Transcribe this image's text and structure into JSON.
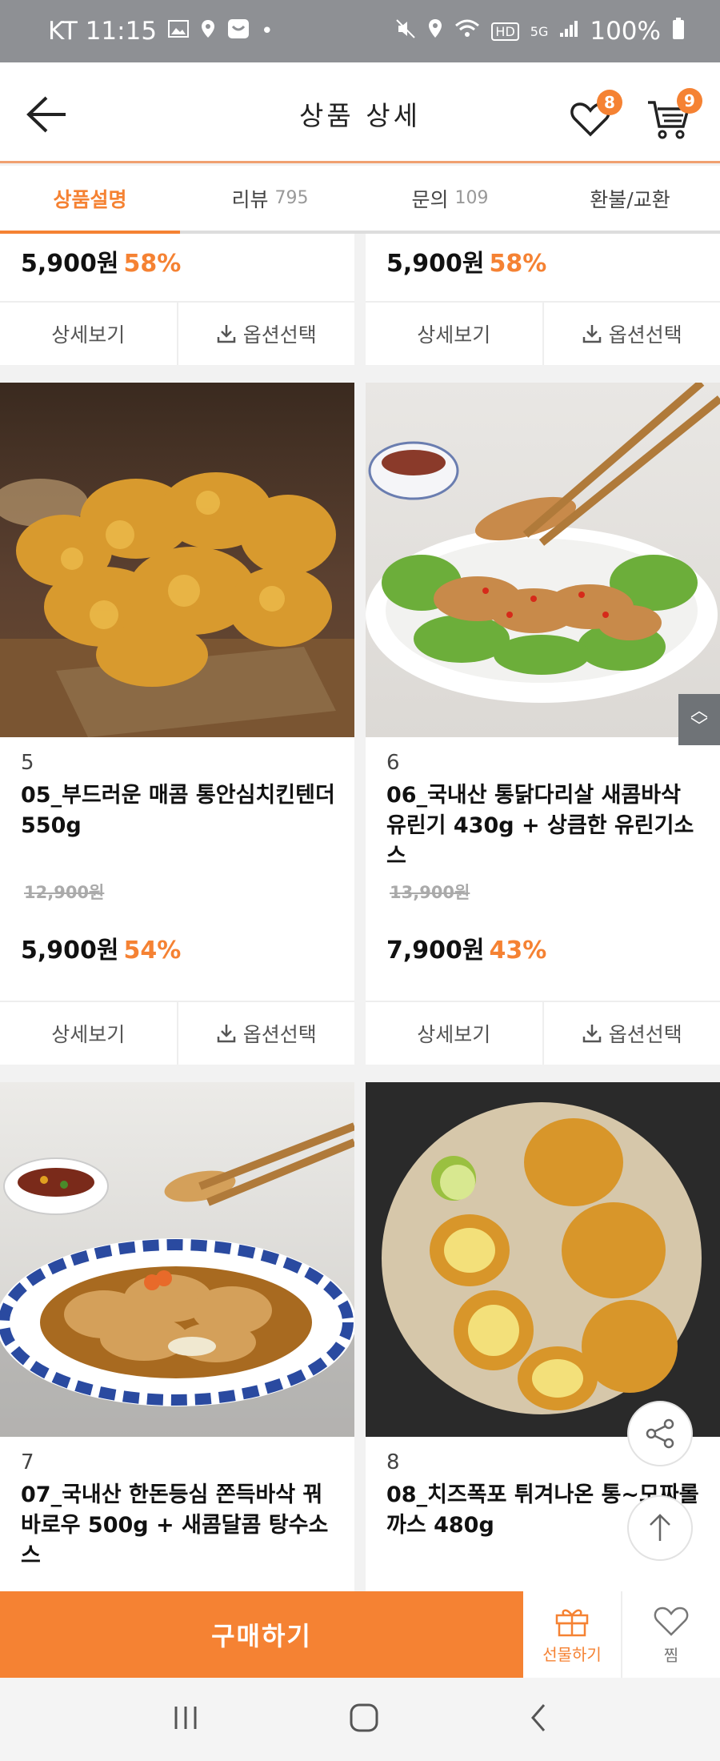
{
  "status": {
    "carrier_time": "KT 11:15",
    "battery": "100%",
    "network_hd": "HD",
    "network_5g": "5G"
  },
  "header": {
    "title": "상품 상세",
    "wishlist_count": "8",
    "cart_count": "9"
  },
  "tabs": [
    {
      "label": "상품설명",
      "count": ""
    },
    {
      "label": "리뷰",
      "count": "795"
    },
    {
      "label": "문의",
      "count": "109"
    },
    {
      "label": "환불/교환",
      "count": ""
    }
  ],
  "partial_row": [
    {
      "price": "5,900원",
      "discount": "58%"
    },
    {
      "price": "5,900원",
      "discount": "58%"
    }
  ],
  "products": [
    {
      "number": "5",
      "name": "05_부드러운 매콤 통안심치킨텐더 550g",
      "original_price": "12,900원",
      "price": "5,900원",
      "discount": "54%"
    },
    {
      "number": "6",
      "name": "06_국내산 통닭다리살 새콤바삭 유린기 430g + 상큼한 유린기소스",
      "original_price": "13,900원",
      "price": "7,900원",
      "discount": "43%"
    },
    {
      "number": "7",
      "name": "07_국내산 한돈등심 쫀득바삭 꿔바로우 500g + 새콤달콤 탕수소스",
      "original_price": "",
      "price": "",
      "discount": ""
    },
    {
      "number": "8",
      "name": "08_치즈폭포 튀겨나온 통~모짜롤까스 480g",
      "original_price": "",
      "price": "",
      "discount": ""
    }
  ],
  "card_actions": {
    "detail": "상세보기",
    "option": "옵션선택"
  },
  "bottom": {
    "buy": "구매하기",
    "gift": "선물하기",
    "zzim": "찜"
  },
  "colors": {
    "accent": "#f58233",
    "status_bar": "#8e9094"
  }
}
